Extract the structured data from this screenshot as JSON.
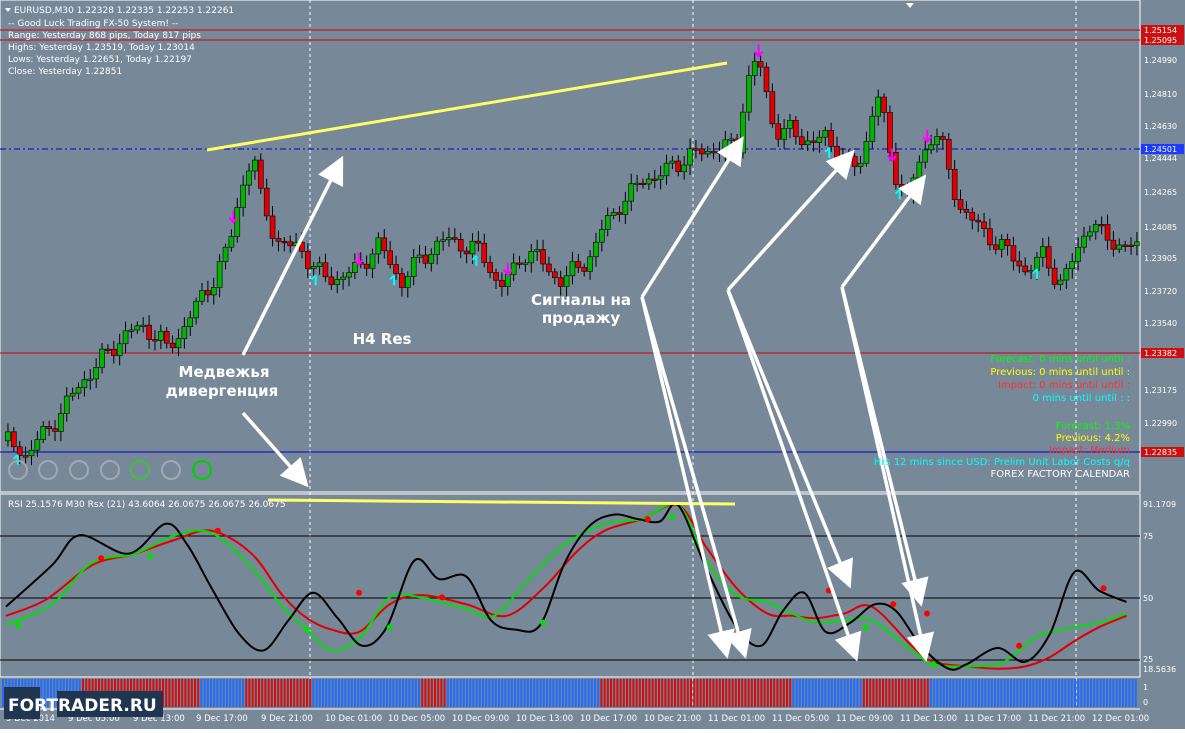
{
  "header": {
    "symbol_line": "EURUSD,M30  1.22328 1.22335 1.22253 1.22261",
    "system_line": "-- Good Luck Trading FX-50 System! --",
    "range_line": "Range: Yesterday 868 pips, Today 817 pips",
    "highs_line": "Highs: Yesterday 1.23519, Today 1.23014",
    "lows_line": "Lows:  Yesterday 1.22651, Today 1.22197",
    "close_line": "Close: Yesterday 1.22851"
  },
  "colors": {
    "background": "#778899",
    "bull": "#00b400",
    "bear": "#e00000",
    "rsi_line": "#000000",
    "fast_line": "#00e000",
    "slow_line": "#e00000",
    "divergence_line": "#ffff66",
    "arrows": "#ffffff",
    "sell_arrow": "#ff00ff",
    "buy_arrow": "#00ffff"
  },
  "annotations": {
    "divergence": [
      "Медвежья",
      "дивергенция"
    ],
    "h4res": "H4 Res",
    "signals": [
      "Сигналы на",
      "продажу"
    ]
  },
  "price_axis": {
    "labels": [
      "1.25154",
      "1.25095",
      "1.24990",
      "1.24810",
      "1.24630",
      "1.24501",
      "1.24444",
      "1.24265",
      "1.24085",
      "1.23905",
      "1.23720",
      "1.23540",
      "1.23382",
      "1.23175",
      "1.22990",
      "1.22835"
    ],
    "marked": [
      "1.25154",
      "1.25095",
      "1.23382",
      "1.22835"
    ],
    "blue_marked": [
      "1.24501"
    ]
  },
  "lower_axis": {
    "top": "91.1709",
    "levels": [
      "75",
      "50",
      "25"
    ],
    "bottom": "18.5636",
    "bar_scale": [
      "1",
      "0"
    ]
  },
  "rsi_header": "RSI 25.1576  M30  Rsx (21) 43.6064 26.0675 26.0675 26.0675",
  "time_axis": [
    "9 Dec 2014",
    "9 Dec 05:00",
    "9 Dec 13:00",
    "9 Dec 17:00",
    "9 Dec 21:00",
    "10 Dec 01:00",
    "10 Dec 05:00",
    "10 Dec 09:00",
    "10 Dec 13:00",
    "10 Dec 17:00",
    "10 Dec 21:00",
    "11 Dec 01:00",
    "11 Dec 05:00",
    "11 Dec 09:00",
    "11 Dec 13:00",
    "11 Dec 17:00",
    "11 Dec 21:00",
    "12 Dec 01:00"
  ],
  "news": {
    "upper": [
      "Forecast: 0 mins until until :",
      "Previous: 0 mins until until :",
      "Impact: 0 mins until until :",
      "0 mins until until : :"
    ],
    "forecast": "Forecast: 1.3%",
    "previous": "Previous: 4.2%",
    "impact": "Impact: Medium",
    "event": "Hrs 12 mins since USD: Prelim Unit Labor Costs q/q",
    "calendar": "FOREX FACTORY CALENDAR"
  },
  "watermark": "FORTRADER.RU",
  "chart_data": {
    "type": "candlestick",
    "symbol": "EURUSD",
    "timeframe": "M30",
    "ylim": [
      1.2265,
      1.2525
    ],
    "levels": {
      "red_top_1": 1.25154,
      "red_top_2": 1.25095,
      "blue_dashed": 1.24501,
      "red_mid": 1.23382,
      "blue_low": 1.22835
    },
    "close_path": [
      [
        0,
        1.2292
      ],
      [
        10,
        1.2285
      ],
      [
        20,
        1.2296
      ],
      [
        30,
        1.231
      ],
      [
        40,
        1.2325
      ],
      [
        50,
        1.2336
      ],
      [
        60,
        1.2348
      ],
      [
        70,
        1.2352
      ],
      [
        78,
        1.2347
      ],
      [
        82,
        1.234
      ],
      [
        86,
        1.2345
      ],
      [
        96,
        1.2361
      ],
      [
        106,
        1.2378
      ],
      [
        114,
        1.2395
      ],
      [
        120,
        1.2426
      ],
      [
        126,
        1.2444
      ],
      [
        130,
        1.242
      ],
      [
        134,
        1.241
      ],
      [
        138,
        1.2398
      ],
      [
        144,
        1.2394
      ],
      [
        150,
        1.2395
      ],
      [
        156,
        1.2385
      ],
      [
        162,
        1.2378
      ],
      [
        168,
        1.2378
      ],
      [
        174,
        1.238
      ],
      [
        180,
        1.2383
      ],
      [
        186,
        1.2392
      ],
      [
        190,
        1.2395
      ],
      [
        196,
        1.2386
      ],
      [
        202,
        1.2376
      ],
      [
        206,
        1.2382
      ],
      [
        212,
        1.2388
      ],
      [
        218,
        1.2395
      ],
      [
        226,
        1.2398
      ],
      [
        232,
        1.2396
      ],
      [
        240,
        1.2393
      ],
      [
        246,
        1.2386
      ],
      [
        252,
        1.2373
      ],
      [
        258,
        1.238
      ],
      [
        264,
        1.2392
      ],
      [
        270,
        1.239
      ],
      [
        276,
        1.2383
      ],
      [
        284,
        1.2376
      ],
      [
        292,
        1.2384
      ],
      [
        300,
        1.2392
      ],
      [
        306,
        1.2408
      ],
      [
        314,
        1.2418
      ],
      [
        320,
        1.2423
      ],
      [
        326,
        1.2433
      ],
      [
        332,
        1.243
      ],
      [
        340,
        1.2438
      ],
      [
        348,
        1.2442
      ],
      [
        356,
        1.2445
      ],
      [
        362,
        1.2447
      ],
      [
        368,
        1.2447
      ],
      [
        374,
        1.2448
      ],
      [
        376,
        1.247
      ],
      [
        380,
        1.2488
      ],
      [
        384,
        1.2493
      ],
      [
        388,
        1.2475
      ],
      [
        392,
        1.2458
      ],
      [
        396,
        1.2454
      ],
      [
        400,
        1.2456
      ],
      [
        406,
        1.2452
      ],
      [
        412,
        1.245
      ],
      [
        418,
        1.2452
      ],
      [
        424,
        1.2446
      ],
      [
        428,
        1.244
      ],
      [
        432,
        1.2435
      ],
      [
        436,
        1.244
      ],
      [
        440,
        1.2455
      ],
      [
        444,
        1.2478
      ],
      [
        448,
        1.246
      ],
      [
        452,
        1.2438
      ],
      [
        456,
        1.2428
      ],
      [
        460,
        1.242
      ],
      [
        464,
        1.2433
      ],
      [
        470,
        1.2448
      ],
      [
        474,
        1.2458
      ],
      [
        478,
        1.2446
      ],
      [
        482,
        1.2428
      ],
      [
        486,
        1.2418
      ],
      [
        492,
        1.241
      ],
      [
        498,
        1.2402
      ],
      [
        502,
        1.24
      ],
      [
        508,
        1.2395
      ],
      [
        514,
        1.2388
      ],
      [
        520,
        1.2383
      ],
      [
        526,
        1.2386
      ],
      [
        530,
        1.2391
      ],
      [
        534,
        1.2381
      ],
      [
        538,
        1.2376
      ],
      [
        542,
        1.2382
      ],
      [
        546,
        1.239
      ],
      [
        552,
        1.2408
      ],
      [
        556,
        1.2405
      ],
      [
        560,
        1.2399
      ],
      [
        566,
        1.2397
      ],
      [
        572,
        1.2395
      ],
      [
        578,
        1.2393
      ]
    ],
    "rsi": {
      "series": [
        {
          "name": "Rsx",
          "points": [
            [
              0,
              47
            ],
            [
              30,
              65
            ],
            [
              48,
              78
            ],
            [
              80,
              70
            ],
            [
              104,
              83
            ],
            [
              118,
              74
            ],
            [
              134,
              55
            ],
            [
              152,
              35
            ],
            [
              168,
              28
            ],
            [
              184,
              41
            ],
            [
              200,
              53
            ],
            [
              216,
              42
            ],
            [
              232,
              30
            ],
            [
              248,
              38
            ],
            [
              266,
              67
            ],
            [
              282,
              59
            ],
            [
              300,
              60
            ],
            [
              316,
              41
            ],
            [
              332,
              37
            ],
            [
              348,
              39
            ],
            [
              364,
              66
            ],
            [
              380,
              82
            ],
            [
              396,
              87
            ],
            [
              412,
              85
            ],
            [
              426,
              84
            ],
            [
              438,
              91
            ],
            [
              456,
              64
            ],
            [
              476,
              38
            ],
            [
              492,
              30
            ],
            [
              506,
              45
            ],
            [
              520,
              53
            ],
            [
              534,
              36
            ],
            [
              550,
              40
            ],
            [
              566,
              48
            ],
            [
              580,
              45
            ],
            [
              596,
              30
            ],
            [
              614,
              20
            ],
            [
              626,
              22
            ],
            [
              646,
              29
            ],
            [
              664,
              23
            ],
            [
              680,
              35
            ],
            [
              696,
              62
            ],
            [
              712,
              54
            ],
            [
              730,
              49
            ]
          ]
        },
        {
          "name": "Fast",
          "points": [
            [
              0,
              39
            ],
            [
              30,
              48
            ],
            [
              56,
              66
            ],
            [
              84,
              70
            ],
            [
              110,
              78
            ],
            [
              134,
              79
            ],
            [
              160,
              64
            ],
            [
              180,
              47
            ],
            [
              196,
              37
            ],
            [
              212,
              28
            ],
            [
              230,
              33
            ],
            [
              250,
              51
            ],
            [
              270,
              51
            ],
            [
              300,
              46
            ],
            [
              318,
              43
            ],
            [
              342,
              60
            ],
            [
              364,
              74
            ],
            [
              390,
              83
            ],
            [
              414,
              85
            ],
            [
              438,
              91
            ],
            [
              456,
              67
            ],
            [
              476,
              52
            ],
            [
              496,
              49
            ],
            [
              512,
              44
            ],
            [
              528,
              40
            ],
            [
              546,
              41
            ],
            [
              564,
              41
            ],
            [
              590,
              28
            ],
            [
              604,
              22
            ],
            [
              626,
              21
            ],
            [
              650,
              23
            ],
            [
              672,
              34
            ],
            [
              696,
              38
            ],
            [
              712,
              40
            ],
            [
              730,
              44
            ]
          ]
        },
        {
          "name": "Slow",
          "points": [
            [
              0,
              43
            ],
            [
              26,
              50
            ],
            [
              56,
              65
            ],
            [
              84,
              70
            ],
            [
              110,
              76
            ],
            [
              134,
              80
            ],
            [
              160,
              70
            ],
            [
              180,
              52
            ],
            [
              196,
              42
            ],
            [
              212,
              37
            ],
            [
              230,
              36
            ],
            [
              250,
              48
            ],
            [
              270,
              52
            ],
            [
              300,
              48
            ],
            [
              326,
              43
            ],
            [
              350,
              55
            ],
            [
              372,
              71
            ],
            [
              390,
              80
            ],
            [
              414,
              85
            ],
            [
              438,
              91
            ],
            [
              456,
              73
            ],
            [
              476,
              55
            ],
            [
              496,
              44
            ],
            [
              512,
              43
            ],
            [
              528,
              42
            ],
            [
              546,
              44
            ],
            [
              564,
              47
            ],
            [
              590,
              30
            ],
            [
              604,
              23
            ],
            [
              626,
              21
            ],
            [
              646,
              20
            ],
            [
              664,
              21
            ],
            [
              680,
              25
            ],
            [
              696,
              32
            ],
            [
              712,
              38
            ],
            [
              730,
              43
            ]
          ]
        }
      ],
      "levels": [
        75,
        50,
        25
      ],
      "ylim": [
        18.5636,
        91.1709
      ]
    }
  }
}
